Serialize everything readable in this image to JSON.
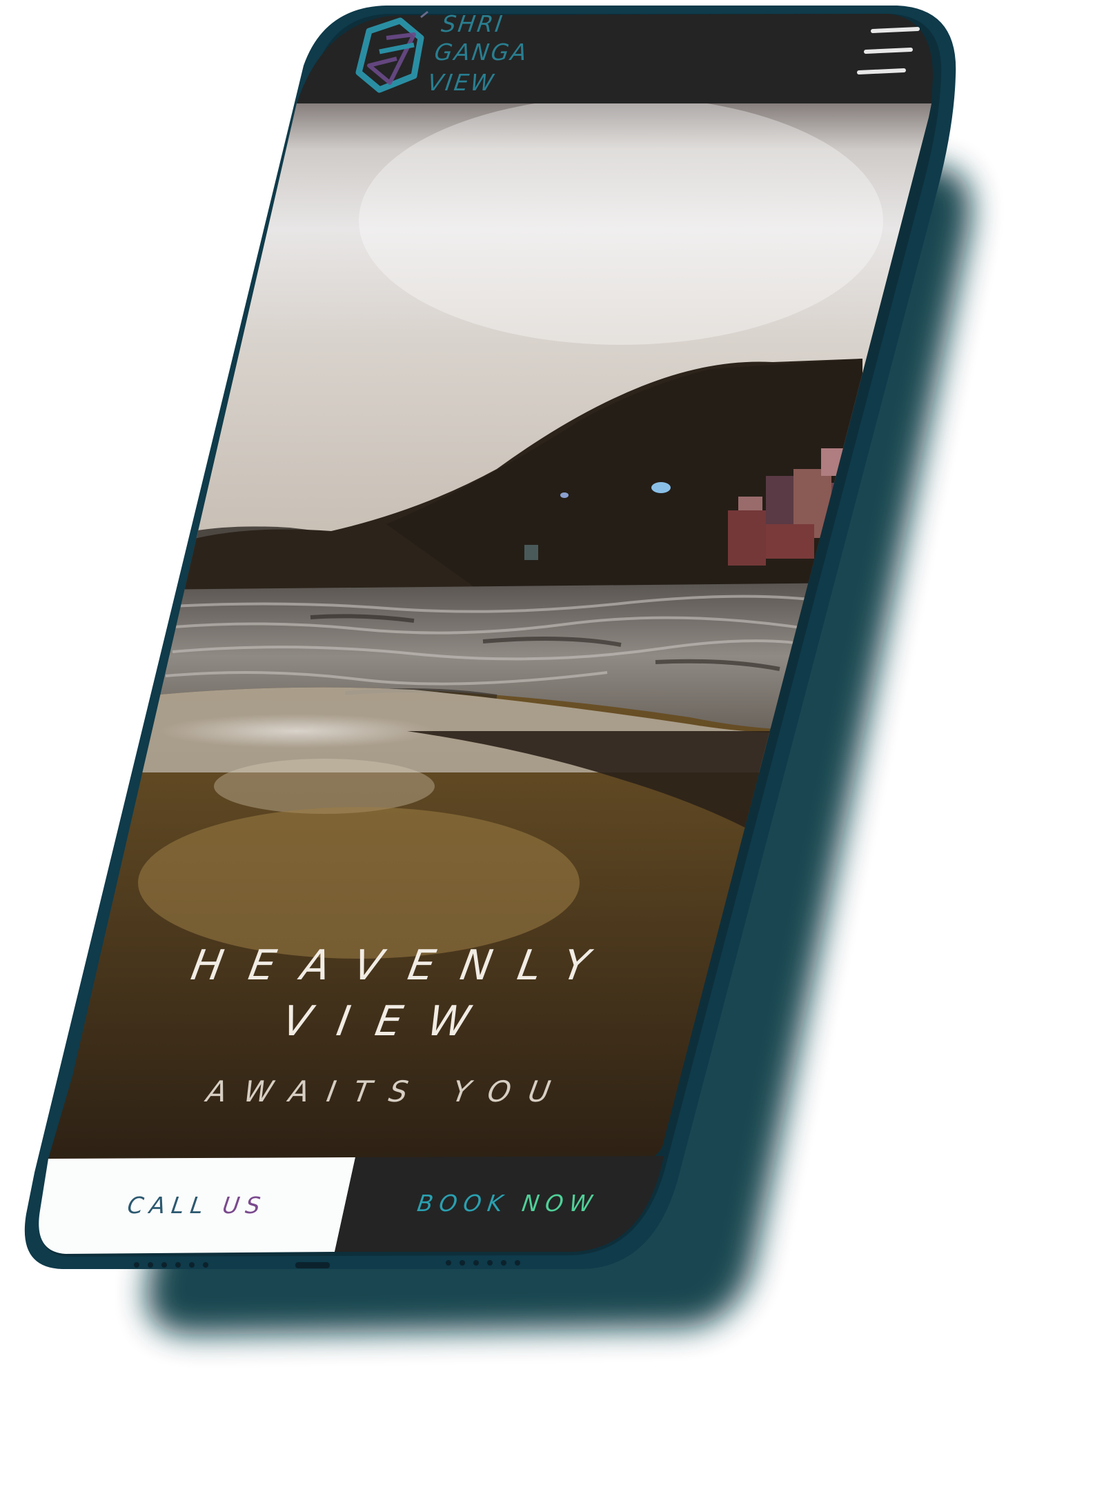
{
  "header": {
    "brand_line_1": "SHRI",
    "brand_line_2": "GANGA",
    "brand_line_3": "VIEW"
  },
  "hero": {
    "line_1": "HEAVENLY",
    "line_2": "VIEW",
    "line_3": "AWAITS YOU"
  },
  "cta": {
    "call_word_1": "CALL",
    "call_word_2": "US",
    "book_word_1": "BOOK",
    "book_word_2": "NOW"
  },
  "icons": {
    "logo": "hexagon-g-logo-icon",
    "menu": "hamburger-menu-icon"
  },
  "colors": {
    "phone_frame": "#0f3b4b",
    "header_bg": "#242424",
    "book_bg": "#242424",
    "call_bg": "#fbfcfc",
    "brand_teal": "#2a8ea3",
    "book_green": "#4fd098",
    "call_purple": "#7a4a8e"
  }
}
